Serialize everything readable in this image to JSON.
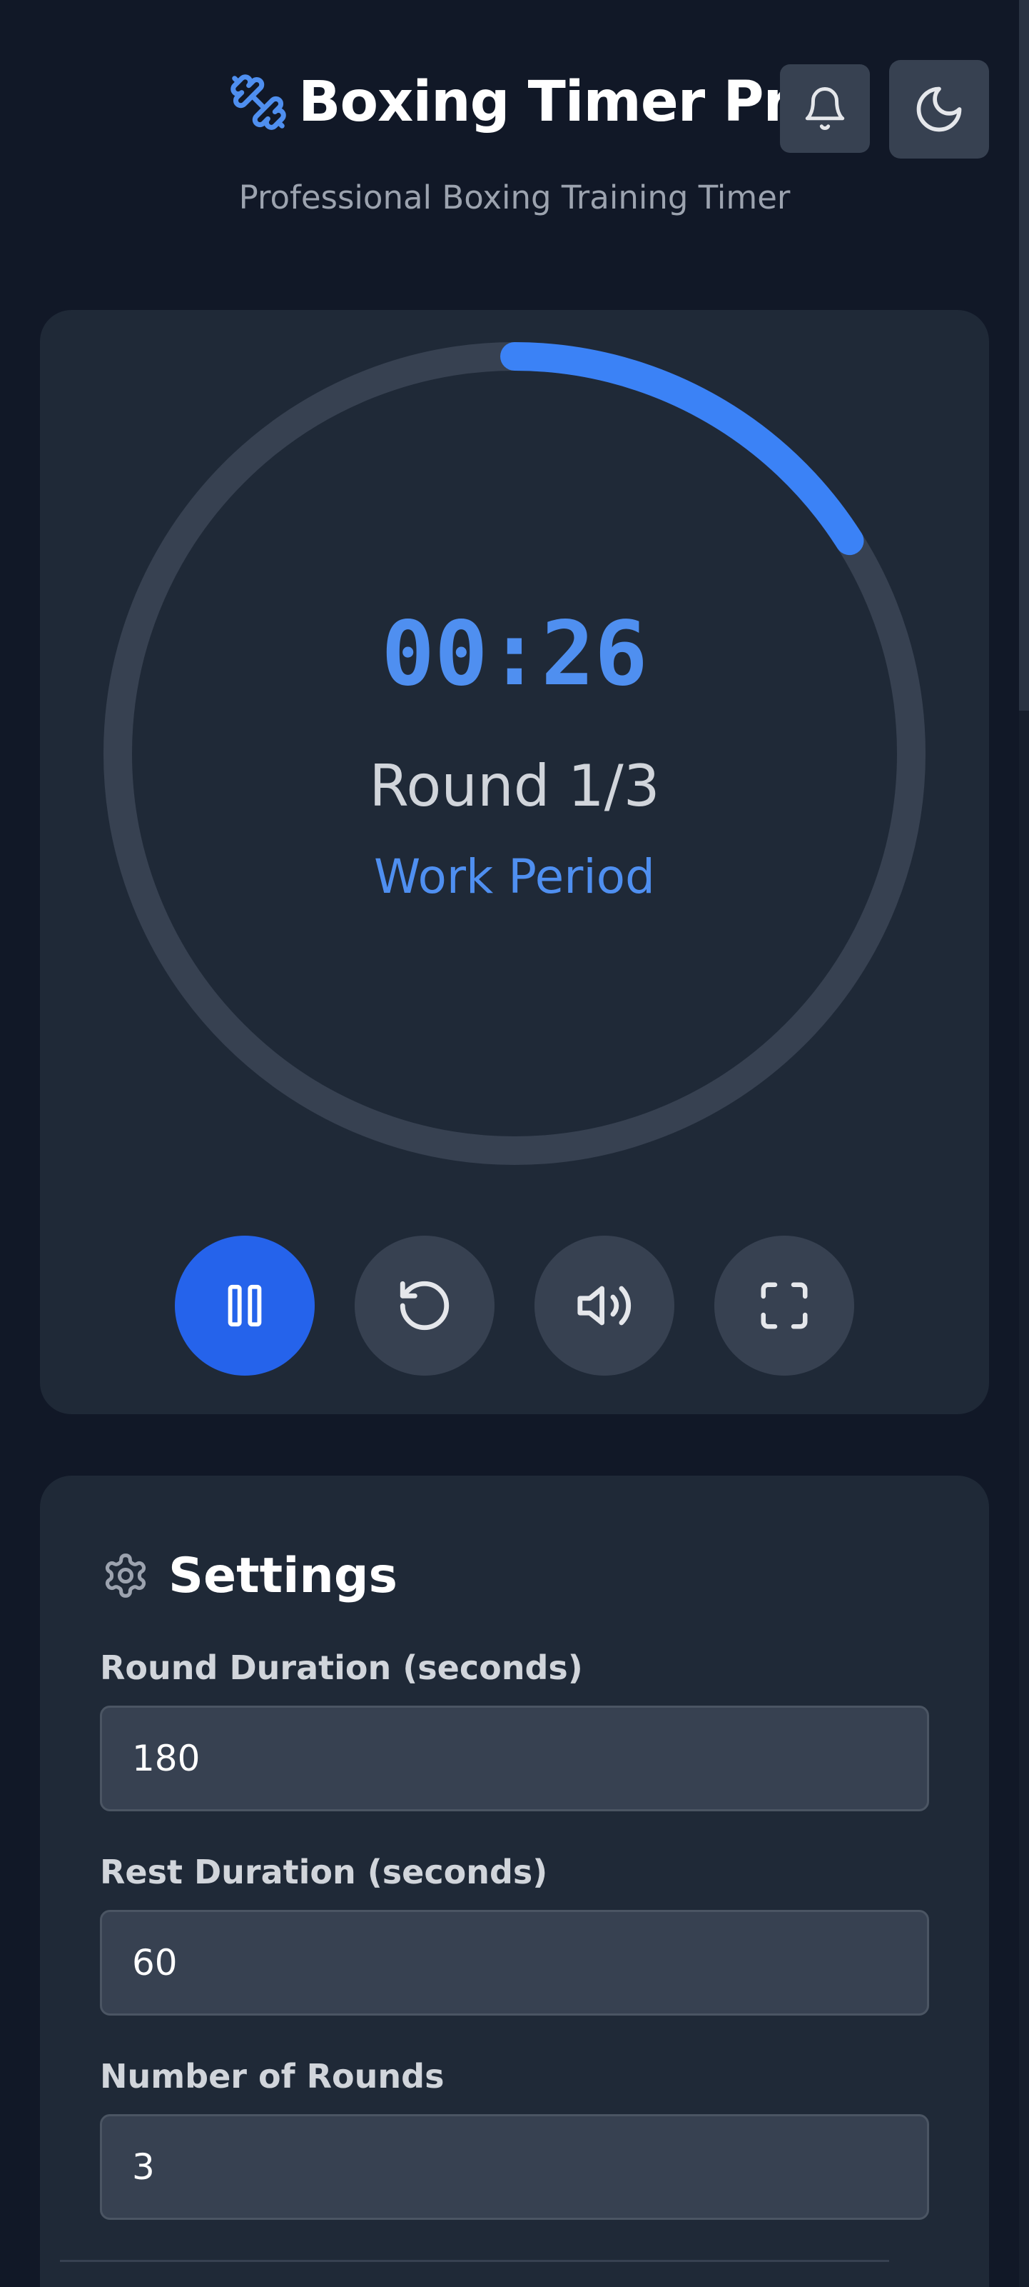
{
  "header": {
    "title": "Boxing Timer Pro",
    "subtitle": "Professional Boxing Training Timer",
    "title_icon": "dumbbell-icon",
    "notification_icon": "bell-icon",
    "theme_icon": "moon-icon"
  },
  "timer": {
    "time": "00:26",
    "round": "Round 1/3",
    "period": "Work Period",
    "progress_fraction": 0.16
  },
  "controls": {
    "pause_icon": "pause-icon",
    "reset_icon": "reset-icon",
    "sound_icon": "volume-icon",
    "fullscreen_icon": "fullscreen-icon"
  },
  "settings": {
    "title": "Settings",
    "icon": "gear-icon",
    "fields": [
      {
        "label": "Round Duration (seconds)",
        "value": "180"
      },
      {
        "label": "Rest Duration (seconds)",
        "value": "60"
      },
      {
        "label": "Number of Rounds",
        "value": "3"
      }
    ]
  },
  "colors": {
    "background": "#111827",
    "card": "#1f2937",
    "accent": "#3b82f6",
    "primary_button": "#2563eb",
    "ring_track": "#374151"
  }
}
